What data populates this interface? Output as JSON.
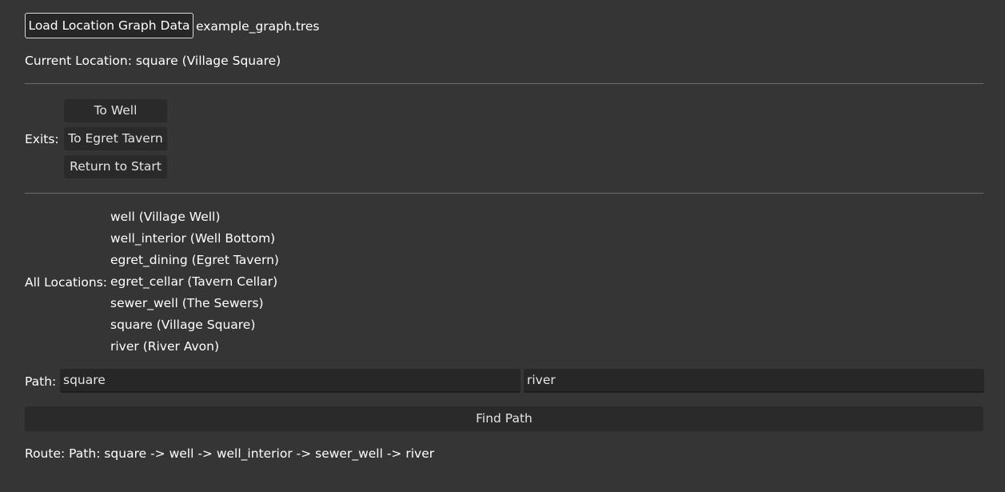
{
  "header": {
    "load_button_label": "Load Location Graph Data",
    "file_name": "example_graph.tres"
  },
  "current_location": "Current Location: square (Village Square)",
  "exits": {
    "label": "Exits:",
    "buttons": [
      "To Well",
      "To Egret Tavern",
      "Return to Start"
    ]
  },
  "all_locations": {
    "label": "All Locations:",
    "items": [
      "well (Village Well)",
      "well_interior (Well Bottom)",
      "egret_dining (Egret Tavern)",
      "egret_cellar (Tavern Cellar)",
      "sewer_well (The Sewers)",
      "square (Village Square)",
      "river (River Avon)"
    ]
  },
  "path": {
    "label": "Path:",
    "from_value": "square",
    "to_value": "river",
    "find_button_label": "Find Path"
  },
  "route": "Route: Path: square -> well -> well_interior -> sewer_well -> river"
}
